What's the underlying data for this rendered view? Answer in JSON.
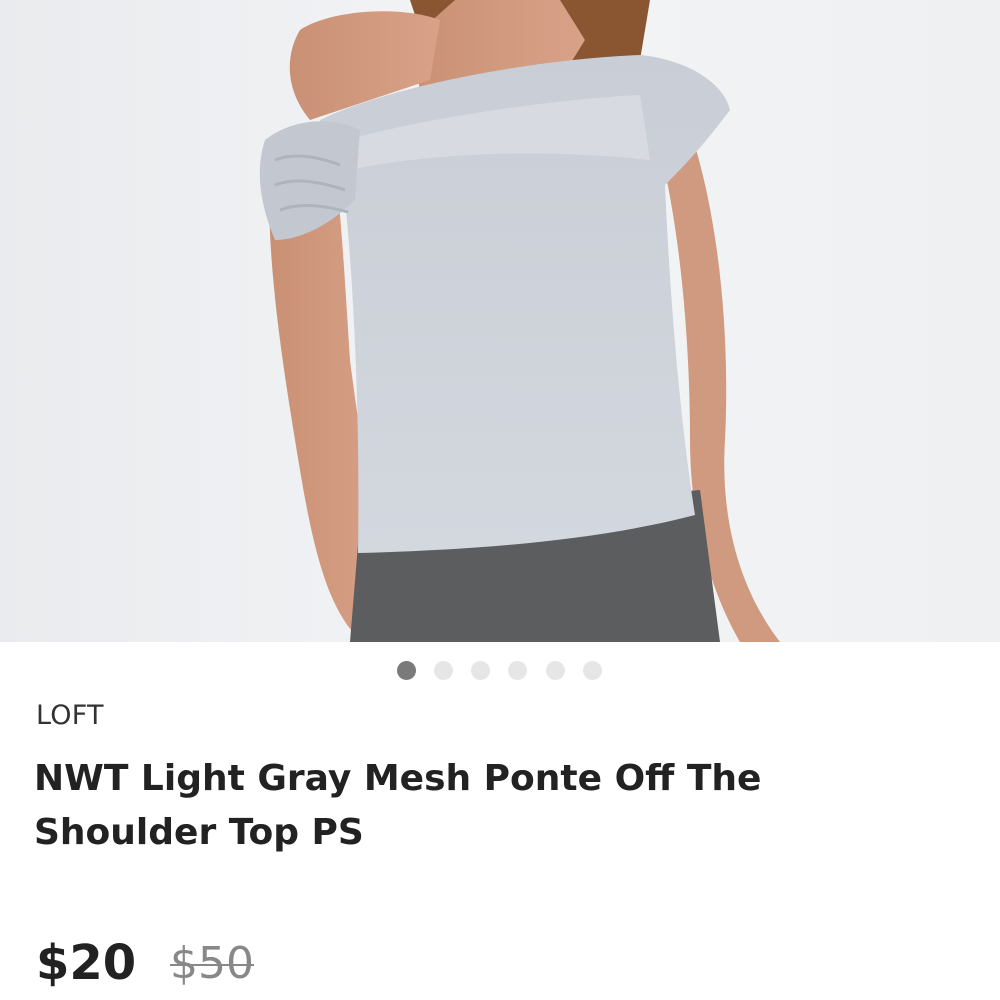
{
  "product": {
    "brand": "LOFT",
    "title": "NWT Light Gray Mesh Ponte Off The Shoulder Top PS",
    "price": "$20",
    "original_price": "$50"
  },
  "gallery": {
    "image_count": 6,
    "active_index": 0
  }
}
